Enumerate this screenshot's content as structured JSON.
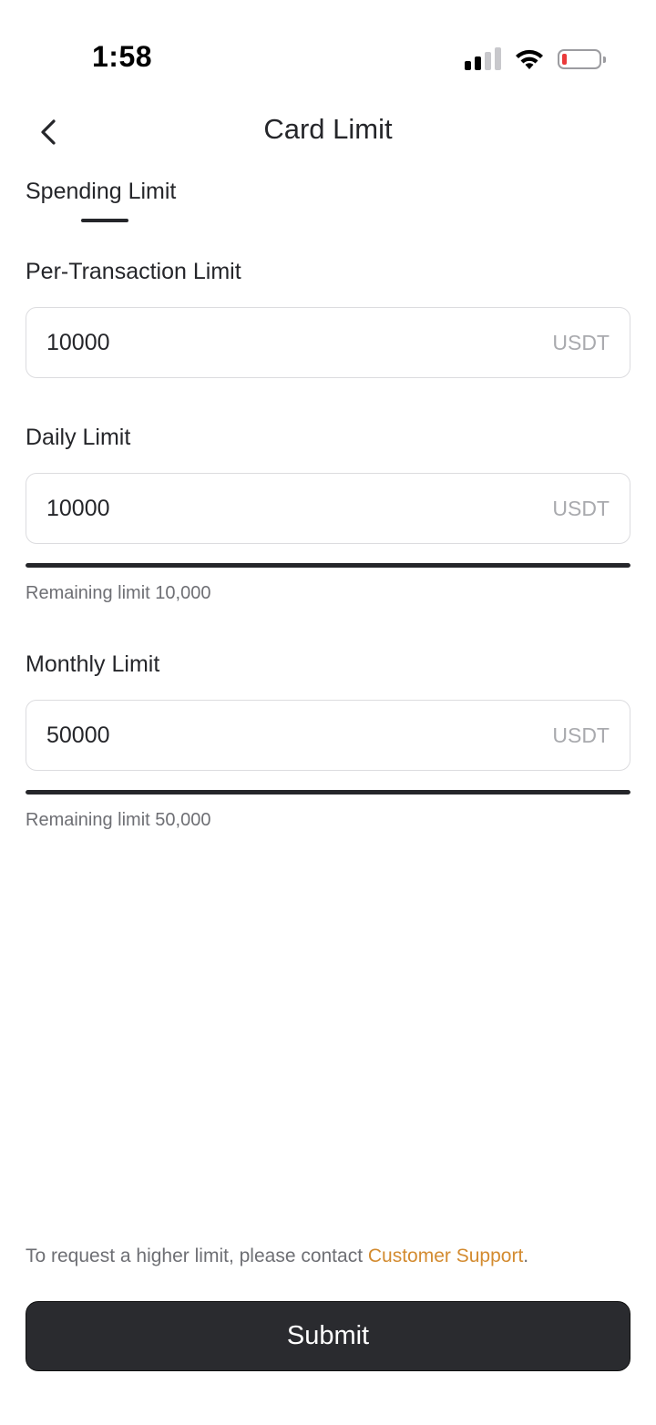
{
  "status_bar": {
    "time": "1:58",
    "battery_level": 0.12
  },
  "header": {
    "title": "Card Limit",
    "back_icon": "chevron-left-icon"
  },
  "tabs": [
    {
      "label": "Spending Limit",
      "active": true
    }
  ],
  "fields": {
    "per_transaction": {
      "label": "Per-Transaction Limit",
      "value": "10000",
      "unit": "USDT"
    },
    "daily": {
      "label": "Daily Limit",
      "value": "10000",
      "unit": "USDT",
      "remaining_text": "Remaining limit 10,000",
      "remaining_fraction": 1.0
    },
    "monthly": {
      "label": "Monthly Limit",
      "value": "50000",
      "unit": "USDT",
      "remaining_text": "Remaining limit 50,000",
      "remaining_fraction": 1.0
    }
  },
  "footer": {
    "note_prefix": "To request a higher limit, please contact ",
    "note_link": "Customer Support",
    "note_suffix": ".",
    "link_color": "#d38b30",
    "submit_label": "Submit"
  }
}
